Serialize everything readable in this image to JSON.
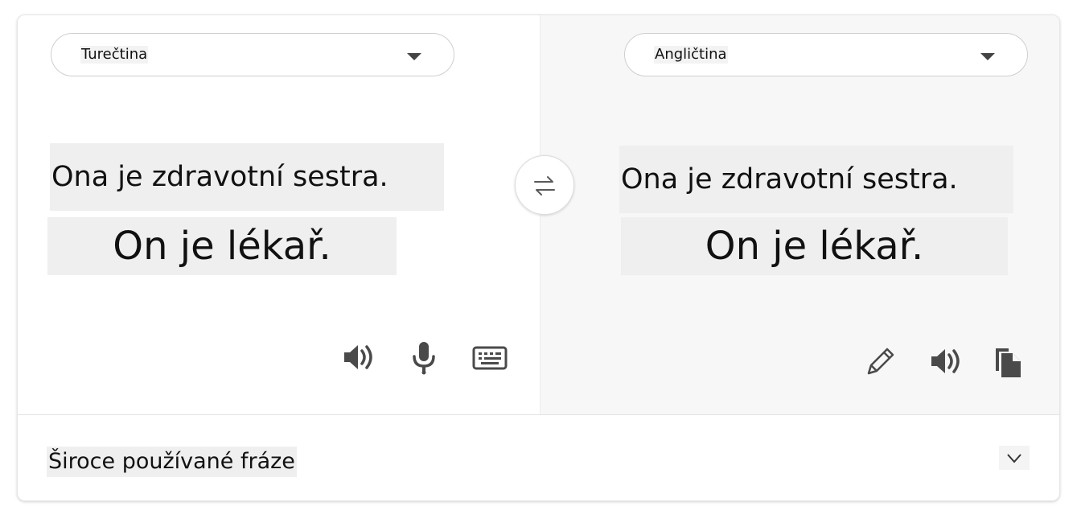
{
  "source": {
    "language": "Turečtina",
    "text_line1": "Ona je zdravotní sestra.",
    "text_line2": "On je lékař."
  },
  "target": {
    "language": "Angličtina",
    "text_line1": "Ona je zdravotní sestra.",
    "text_line2": "On je lékař."
  },
  "icons": {
    "swap": "swap-arrows-icon",
    "source_speaker": "speaker-icon",
    "microphone": "microphone-icon",
    "keyboard": "keyboard-icon",
    "edit": "pencil-icon",
    "target_speaker": "speaker-icon",
    "copy": "copy-icon",
    "expand": "chevron-down-icon"
  },
  "footer": {
    "phrases_label": "Široce používané fráze"
  },
  "colors": {
    "icon": "#4a4a4a",
    "target_pane_bg": "#f7f7f7",
    "text_highlight_bg": "#efefef"
  }
}
